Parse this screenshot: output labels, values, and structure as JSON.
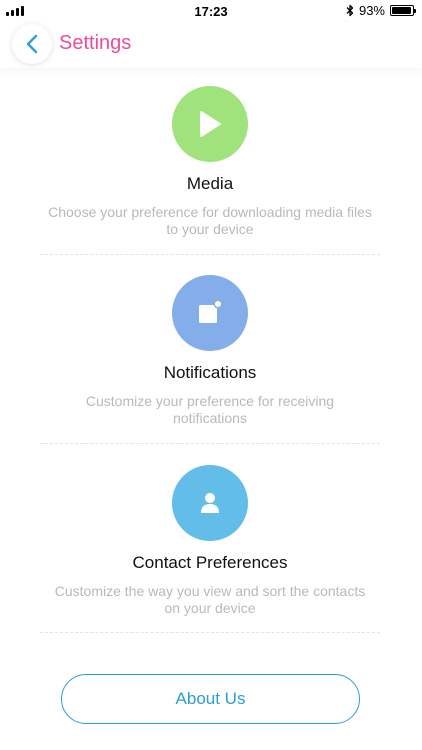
{
  "status_bar": {
    "time": "17:23",
    "battery_percent": "93%",
    "battery_level": 0.93
  },
  "nav": {
    "title": "Settings",
    "accent_color": "#ee4c9b"
  },
  "sections": [
    {
      "title": "Media",
      "description": "Choose your preference for downloading media files to your device",
      "icon": "play-icon",
      "color": "#a0e27c"
    },
    {
      "title": "Notifications",
      "description": "Customize your preference for receiving notifications",
      "icon": "notification-icon",
      "color": "#84aee9"
    },
    {
      "title": "Contact Preferences",
      "description": "Customize the way you view and sort the contacts on your device",
      "icon": "user-icon",
      "color": "#62bde9"
    }
  ],
  "about_button": {
    "label": "About Us",
    "color": "#2a9fd6"
  }
}
